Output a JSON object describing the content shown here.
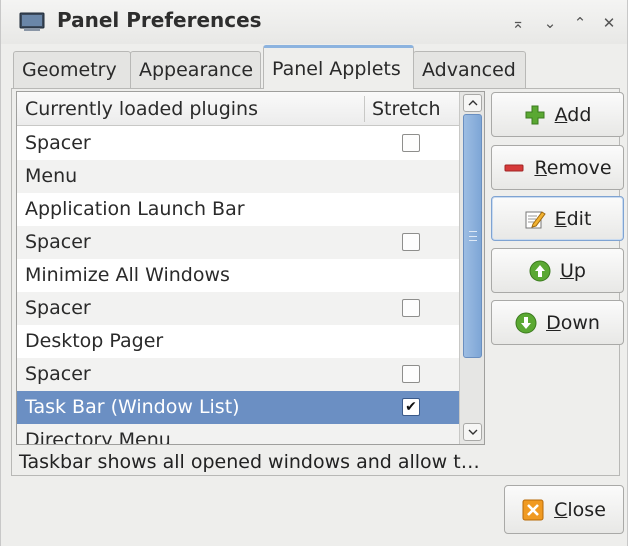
{
  "window": {
    "title": "Panel Preferences",
    "controls": {
      "shade": "⌅",
      "minimize": "⌄",
      "maximize": "⌃",
      "close": "✕"
    }
  },
  "tabs": [
    {
      "label": "Geometry",
      "active": false
    },
    {
      "label": "Appearance",
      "active": false
    },
    {
      "label": "Panel Applets",
      "active": true
    },
    {
      "label": "Advanced",
      "active": false
    }
  ],
  "plugin_list": {
    "columns": {
      "plugins": "Currently loaded plugins",
      "stretch": "Stretch"
    },
    "rows": [
      {
        "name": "Spacer",
        "stretch": "unchecked",
        "mark": ""
      },
      {
        "name": "Menu",
        "stretch": "none",
        "mark": ""
      },
      {
        "name": "Application Launch Bar",
        "stretch": "none",
        "mark": ""
      },
      {
        "name": "Spacer",
        "stretch": "unchecked",
        "mark": ""
      },
      {
        "name": "Minimize All Windows",
        "stretch": "none",
        "mark": ""
      },
      {
        "name": "Spacer",
        "stretch": "unchecked",
        "mark": ""
      },
      {
        "name": "Desktop Pager",
        "stretch": "none",
        "mark": ""
      },
      {
        "name": "Spacer",
        "stretch": "unchecked",
        "mark": ""
      },
      {
        "name": "Task Bar (Window List)",
        "stretch": "checked",
        "mark": "✔",
        "selected": true
      },
      {
        "name": "Directory Menu",
        "stretch": "none",
        "mark": ""
      }
    ]
  },
  "buttons": {
    "add": {
      "mnemonic": "A",
      "rest": "dd"
    },
    "remove": {
      "mnemonic": "R",
      "rest": "emove"
    },
    "edit": {
      "mnemonic": "E",
      "rest": "dit"
    },
    "up": {
      "mnemonic": "U",
      "rest": "p"
    },
    "down": {
      "mnemonic": "D",
      "rest": "own"
    },
    "close": {
      "mnemonic": "C",
      "rest": "lose"
    }
  },
  "status_text": "Taskbar shows all opened windows and allow t…",
  "colors": {
    "selection": "#6b8fc3",
    "add_icon": "#5aa832",
    "remove_icon": "#d63a3a",
    "up_down_icon": "#5aa832",
    "close_icon": "#f09a22"
  }
}
